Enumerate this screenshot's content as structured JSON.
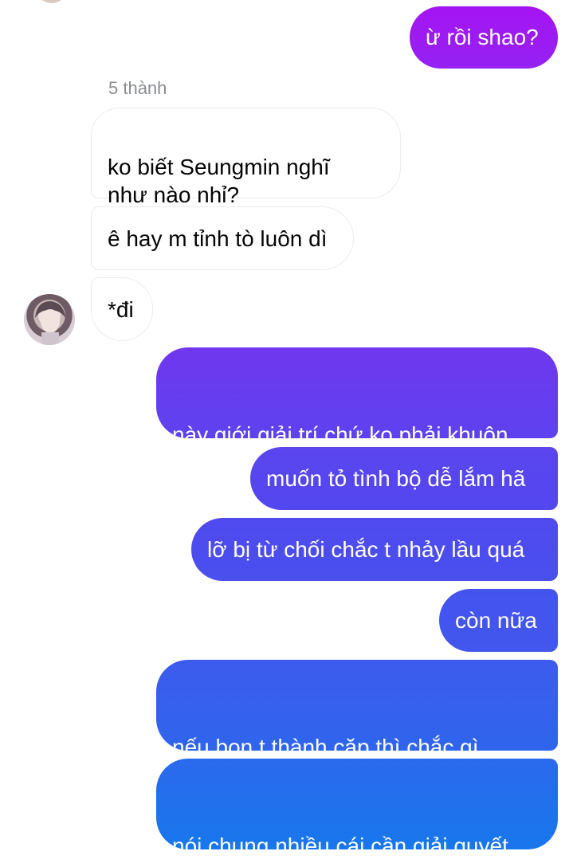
{
  "chat": {
    "sender_name": "5 thành",
    "messages": [
      {
        "from": "me",
        "text": "ừ rồi shao?"
      },
      {
        "from": "them",
        "text": "ko biết Seungmin nghĩ\nnhư nào nhỉ?"
      },
      {
        "from": "them",
        "text": "ê hay m tỉnh tò luôn dì"
      },
      {
        "from": "them",
        "text": "*đi"
      },
      {
        "from": "me",
        "text": "này giới giải trí chứ ko phải khuôn\nviên trường học"
      },
      {
        "from": "me",
        "text": "muốn tỏ tình bộ dễ lắm hã"
      },
      {
        "from": "me",
        "text": "lỡ bị từ chối chắc t nhảy lầu quá"
      },
      {
        "from": "me",
        "text": "còn nữa"
      },
      {
        "from": "me",
        "text": "nếu bọn t thành cặp thì chắc gì\nngta ủng hộ"
      },
      {
        "from": "me",
        "text": "nói chung nhiều cái cần giải quyết\nlắm"
      }
    ]
  },
  "colors": {
    "outgoing_gradient_top": "#9a1cf2",
    "outgoing_gradient_mid": "#5544ef",
    "outgoing_gradient_bottom": "#1877ec",
    "incoming_bg": "#ffffff",
    "incoming_border": "#ececec"
  }
}
